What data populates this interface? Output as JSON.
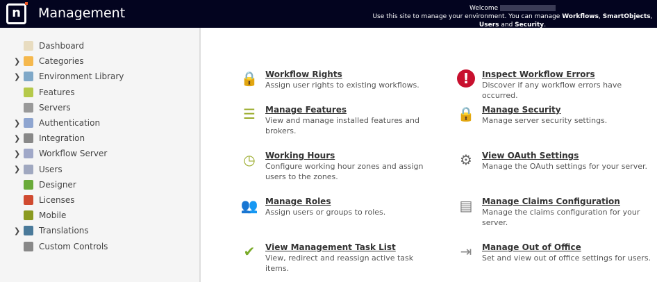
{
  "header": {
    "app_title": "Management",
    "welcome": "Welcome",
    "intro": "Use this site to manage your environment. You can manage ",
    "k1": "Workflows",
    "k2": "SmartObjects",
    "k3": "Users",
    "and": " and ",
    "k4": "Security",
    "sep": ", ",
    "end": "."
  },
  "sidebar": {
    "items": [
      {
        "label": "Dashboard",
        "expand": false,
        "icon": "dashboard-icon",
        "color": "#e8dcc0"
      },
      {
        "label": "Categories",
        "expand": true,
        "icon": "folder-icon",
        "color": "#f5b84d"
      },
      {
        "label": "Environment Library",
        "expand": true,
        "icon": "library-icon",
        "color": "#7fa8c8"
      },
      {
        "label": "Features",
        "expand": false,
        "icon": "features-icon",
        "color": "#b5c94a"
      },
      {
        "label": "Servers",
        "expand": false,
        "icon": "server-icon",
        "color": "#999999"
      },
      {
        "label": "Authentication",
        "expand": true,
        "icon": "key-icon",
        "color": "#8ea5d0"
      },
      {
        "label": "Integration",
        "expand": true,
        "icon": "puzzle-icon",
        "color": "#888888"
      },
      {
        "label": "Workflow Server",
        "expand": true,
        "icon": "workflow-server-icon",
        "color": "#a0a8c8"
      },
      {
        "label": "Users",
        "expand": true,
        "icon": "user-icon",
        "color": "#a0a8c0"
      },
      {
        "label": "Designer",
        "expand": false,
        "icon": "designer-icon",
        "color": "#6aab3a"
      },
      {
        "label": "Licenses",
        "expand": false,
        "icon": "license-icon",
        "color": "#d04a30"
      },
      {
        "label": "Mobile",
        "expand": false,
        "icon": "mobile-icon",
        "color": "#8a9a20"
      },
      {
        "label": "Translations",
        "expand": true,
        "icon": "globe-icon",
        "color": "#4a7a9a"
      },
      {
        "label": "Custom Controls",
        "expand": false,
        "icon": "tools-icon",
        "color": "#888888"
      }
    ]
  },
  "cards": [
    {
      "title": "Workflow Rights",
      "desc": "Assign user rights to existing workflows.",
      "icon": "lock-icon",
      "glyph": "🔒",
      "color": "#e8a13a"
    },
    {
      "title": "Inspect Workflow Errors",
      "desc": "Discover if any workflow errors have occurred.",
      "icon": "error-icon",
      "glyph": "!",
      "color": "#c8102e"
    },
    {
      "title": "Manage Features",
      "desc": "View and manage installed features and brokers.",
      "icon": "toggle-icon",
      "glyph": "☰",
      "color": "#9aab2a"
    },
    {
      "title": "Manage Security",
      "desc": "Manage server security settings.",
      "icon": "lock-icon",
      "glyph": "🔒",
      "color": "#e8a13a"
    },
    {
      "title": "Working Hours",
      "desc": "Configure working hour zones and assign users to the zones.",
      "icon": "clock-icon",
      "glyph": "◷",
      "color": "#9aab2a"
    },
    {
      "title": "View OAuth Settings",
      "desc": "Manage the OAuth settings for your server.",
      "icon": "oauth-icon",
      "glyph": "⚙",
      "color": "#666666"
    },
    {
      "title": "Manage Roles",
      "desc": "Assign users or groups to roles.",
      "icon": "roles-icon",
      "glyph": "👥",
      "color": "#6a7a20"
    },
    {
      "title": "Manage Claims Configuration",
      "desc": "Manage the claims configuration for your server.",
      "icon": "claims-icon",
      "glyph": "▤",
      "color": "#777777"
    },
    {
      "title": "View Management Task List",
      "desc": "View, redirect and reassign active task items.",
      "icon": "task-list-icon",
      "glyph": "✔",
      "color": "#7aab2a"
    },
    {
      "title": "Manage Out of Office",
      "desc": "Set and view out of office settings for users.",
      "icon": "out-of-office-icon",
      "glyph": "⇥",
      "color": "#888888"
    }
  ]
}
